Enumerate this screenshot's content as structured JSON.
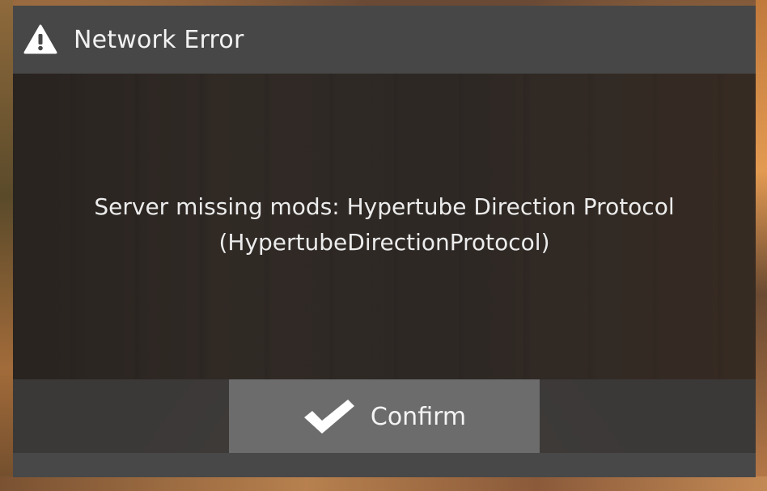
{
  "dialog": {
    "title": "Network Error",
    "title_icon": "warning-icon",
    "message_line1": "Server missing mods: Hypertube Direction Protocol",
    "message_line2": "(HypertubeDirectionProtocol)",
    "confirm_label": "Confirm",
    "confirm_icon": "checkmark-icon"
  },
  "colors": {
    "titlebar": "#474747",
    "button": "#6c6c6c",
    "text": "#f2f2f2"
  }
}
